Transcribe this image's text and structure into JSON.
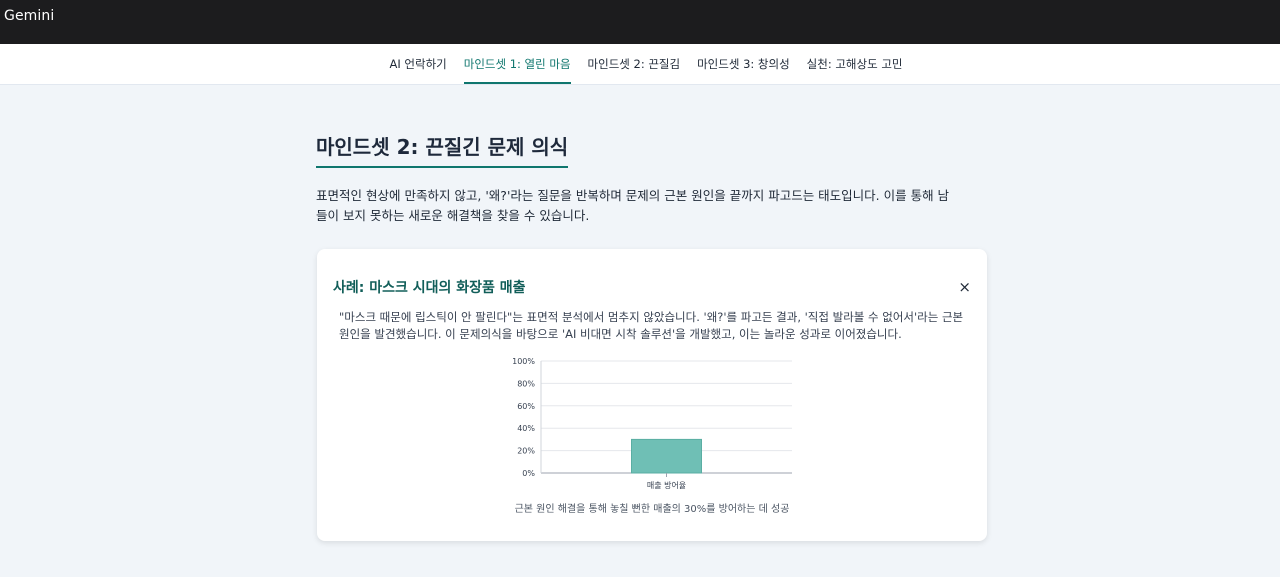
{
  "app": {
    "title": "Gemini"
  },
  "nav": {
    "tabs": [
      {
        "label": "AI 언락하기",
        "active": false
      },
      {
        "label": "마인드셋 1: 열린 마음",
        "active": true
      },
      {
        "label": "마인드셋 2: 끈질김",
        "active": false
      },
      {
        "label": "마인드셋 3: 창의성",
        "active": false
      },
      {
        "label": "실천: 고해상도 고민",
        "active": false
      }
    ]
  },
  "section": {
    "heading": "마인드셋 2: 끈질긴 문제 의식",
    "intro": "표면적인 현상에 만족하지 않고, '왜?'라는 질문을 반복하며 문제의 근본 원인을 끝까지 파고드는 태도입니다. 이를 통해 남들이 보지 못하는 새로운 해결책을 찾을 수 있습니다."
  },
  "card": {
    "title": "사례: 마스크 시대의 화장품 매출",
    "close_label": "×",
    "description": "\"마스크 때문에 립스틱이 안 팔린다\"는 표면적 분석에서 멈추지 않았습니다. '왜?'를 파고든 결과, '직접 발라볼 수 없어서'라는 근본 원인을 발견했습니다. 이 문제의식을 바탕으로 'AI 비대면 시착 솔루션'을 개발했고, 이는 놀라운 성과로 이어졌습니다.",
    "caption": "근본 원인 해결을 통해 놓칠 뻔한 매출의 30%를 방어하는 데 성공"
  },
  "chart_data": {
    "type": "bar",
    "categories": [
      "매출 방어율"
    ],
    "values": [
      30
    ],
    "ylim": [
      0,
      100
    ],
    "yticks": [
      "0%",
      "20%",
      "40%",
      "60%",
      "80%",
      "100%"
    ],
    "tick_values": [
      0,
      20,
      40,
      60,
      80,
      100
    ],
    "grid": true,
    "bar_color": "#6fbfb5",
    "bar_border": "#5aaea3"
  },
  "colors": {
    "accent": "#0f766e",
    "topbar": "#1c1c1e",
    "page_bg": "#f1f5f9"
  }
}
